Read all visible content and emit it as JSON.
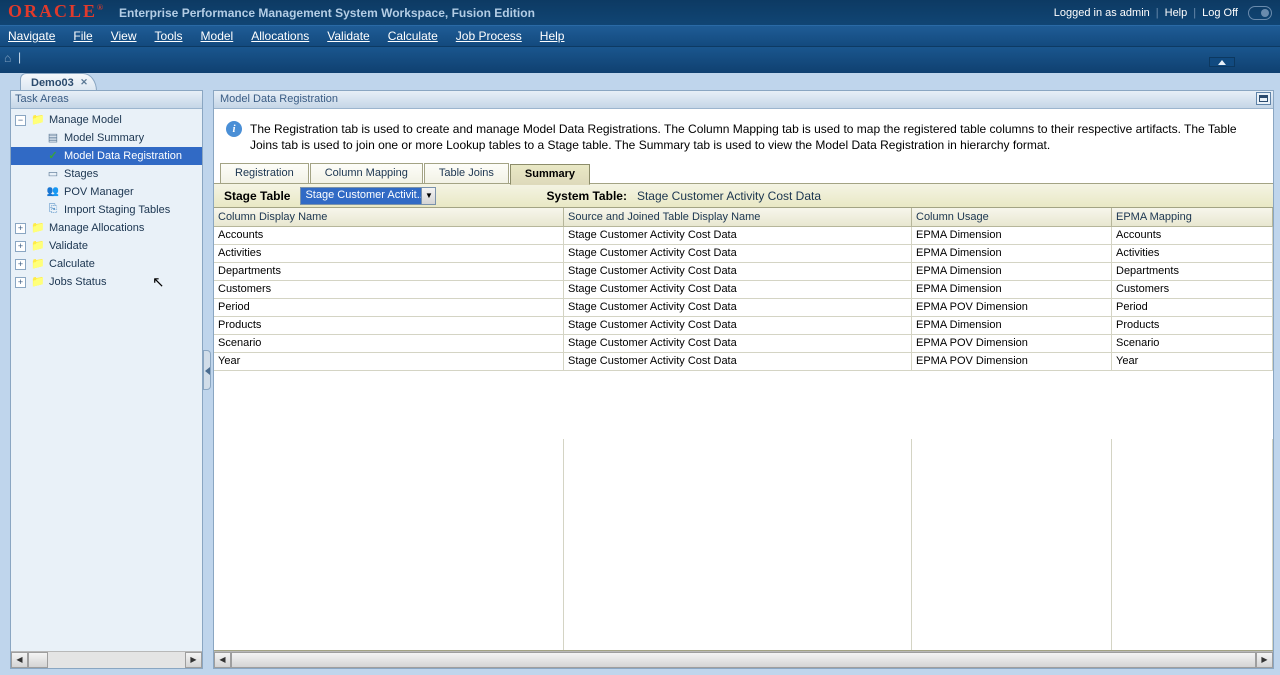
{
  "banner": {
    "brand": "ORACLE",
    "app_title": "Enterprise Performance Management System Workspace, Fusion Edition",
    "login_status": "Logged in as admin",
    "help": "Help",
    "logoff": "Log Off"
  },
  "menu": {
    "navigate": "Navigate",
    "file": "File",
    "view": "View",
    "tools": "Tools",
    "model": "Model",
    "allocations": "Allocations",
    "validate": "Validate",
    "calculate": "Calculate",
    "job_process": "Job Process",
    "help": "Help"
  },
  "doc_tab": {
    "label": "Demo03"
  },
  "task_areas": {
    "title": "Task Areas",
    "manage_model": "Manage Model",
    "model_summary": "Model Summary",
    "model_data_registration": "Model Data Registration",
    "stages": "Stages",
    "pov_manager": "POV Manager",
    "import_staging_tables": "Import Staging Tables",
    "manage_allocations": "Manage Allocations",
    "validate": "Validate",
    "calculate": "Calculate",
    "jobs_status": "Jobs Status"
  },
  "right": {
    "title": "Model Data Registration",
    "info_text": "The Registration tab is used to create and manage Model Data Registrations.  The Column Mapping tab is used to map the registered table columns to their respective artifacts.  The Table Joins tab is used to join one or more Lookup tables to a Stage table.  The Summary tab is used to view the Model Data Registration in hierarchy format.",
    "tabs": {
      "registration": "Registration",
      "column_mapping": "Column Mapping",
      "table_joins": "Table Joins",
      "summary": "Summary"
    },
    "stage_bar": {
      "stage_table_label": "Stage Table",
      "stage_table_value": "Stage Customer Activit...",
      "system_table_label": "System Table:",
      "system_table_value": "Stage Customer Activity Cost Data"
    },
    "grid_headers": {
      "col1": "Column Display Name",
      "col2": "Source and Joined Table Display Name",
      "col3": "Column Usage",
      "col4": "EPMA Mapping"
    },
    "rows": [
      {
        "c1": "Accounts",
        "c2": "Stage Customer Activity Cost Data",
        "c3": "EPMA Dimension",
        "c4": "Accounts"
      },
      {
        "c1": "Activities",
        "c2": "Stage Customer Activity Cost Data",
        "c3": "EPMA Dimension",
        "c4": "Activities"
      },
      {
        "c1": "Departments",
        "c2": "Stage Customer Activity Cost Data",
        "c3": "EPMA Dimension",
        "c4": "Departments"
      },
      {
        "c1": "Customers",
        "c2": "Stage Customer Activity Cost Data",
        "c3": "EPMA Dimension",
        "c4": "Customers"
      },
      {
        "c1": "Period",
        "c2": "Stage Customer Activity Cost Data",
        "c3": "EPMA POV Dimension",
        "c4": "Period"
      },
      {
        "c1": "Products",
        "c2": "Stage Customer Activity Cost Data",
        "c3": "EPMA Dimension",
        "c4": "Products"
      },
      {
        "c1": "Scenario",
        "c2": "Stage Customer Activity Cost Data",
        "c3": "EPMA POV Dimension",
        "c4": "Scenario"
      },
      {
        "c1": "Year",
        "c2": "Stage Customer Activity Cost Data",
        "c3": "EPMA POV Dimension",
        "c4": "Year"
      }
    ]
  }
}
